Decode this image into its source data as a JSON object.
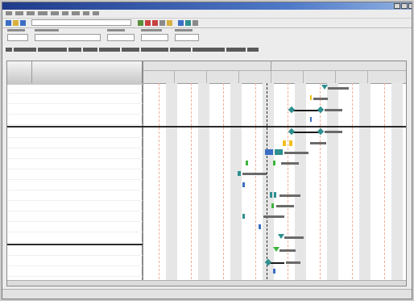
{
  "window": {
    "title": ""
  },
  "colors": {
    "milestone_teal": "#2f8f8f",
    "bar_blue": "#3a6fc4",
    "milestone_green": "#3cb43c",
    "milestone_yellow": "#f0c020",
    "dependency_line": "#1a1a1a",
    "weekend_band": "#e6e6e6",
    "day_divider": "#f0b098"
  },
  "icons": [
    "window-minimize-icon",
    "window-maximize-icon",
    "window-close-icon",
    "new-icon",
    "open-icon",
    "save-icon",
    "print-icon",
    "zoom-in-icon",
    "zoom-out-icon",
    "filter-icon",
    "refresh-icon",
    "calendar-icon",
    "milestone-diamond-icon",
    "task-bar-icon",
    "finish-flag-icon"
  ],
  "grid": {
    "row_count": 20
  }
}
